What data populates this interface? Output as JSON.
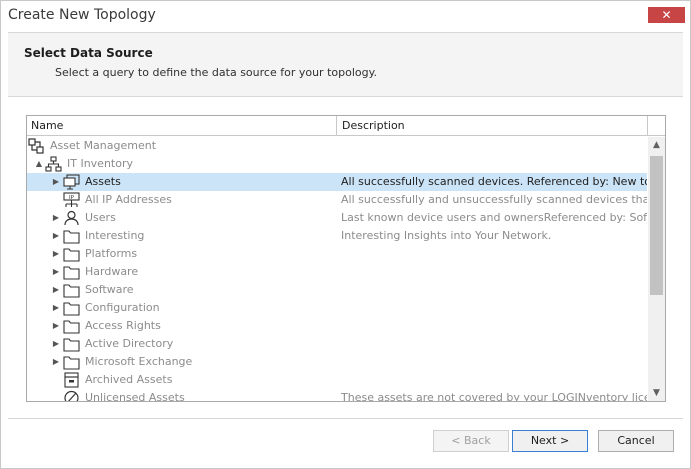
{
  "window": {
    "title": "Create New Topology",
    "close_glyph": "✕"
  },
  "header": {
    "title": "Select Data Source",
    "subtitle": "Select a query to define the data source for your topology."
  },
  "tree": {
    "columns": {
      "name": "Name",
      "description": "Description"
    },
    "rows": [
      {
        "label": "Asset Management",
        "description": "",
        "icon": "network-icon",
        "expander": "",
        "selected": false
      },
      {
        "label": "IT Inventory",
        "description": "",
        "icon": "hierarchy-icon",
        "expander": "▲",
        "selected": false
      },
      {
        "label": "Assets",
        "description": "All successfully scanned devices. Referenced by: New topolo...",
        "icon": "monitor-icon",
        "expander": "▶",
        "selected": true
      },
      {
        "label": "All IP Addresses",
        "description": "All successfully and unsuccessfully scanned devices that hav...",
        "icon": "ip-network-icon",
        "expander": "",
        "selected": false
      },
      {
        "label": "Users",
        "description": "Last known device users and ownersReferenced by: Softwar...",
        "icon": "user-icon",
        "expander": "▶",
        "selected": false
      },
      {
        "label": "Interesting",
        "description": "Interesting Insights into Your Network.",
        "icon": "folder-icon",
        "expander": "▶",
        "selected": false
      },
      {
        "label": "Platforms",
        "description": "",
        "icon": "folder-icon",
        "expander": "▶",
        "selected": false
      },
      {
        "label": "Hardware",
        "description": "",
        "icon": "folder-icon",
        "expander": "▶",
        "selected": false
      },
      {
        "label": "Software",
        "description": "",
        "icon": "folder-icon",
        "expander": "▶",
        "selected": false
      },
      {
        "label": "Configuration",
        "description": "",
        "icon": "folder-icon",
        "expander": "▶",
        "selected": false
      },
      {
        "label": "Access Rights",
        "description": "",
        "icon": "folder-icon",
        "expander": "▶",
        "selected": false
      },
      {
        "label": "Active Directory",
        "description": "",
        "icon": "folder-icon",
        "expander": "▶",
        "selected": false
      },
      {
        "label": "Microsoft Exchange",
        "description": "",
        "icon": "folder-icon",
        "expander": "▶",
        "selected": false
      },
      {
        "label": "Archived Assets",
        "description": "",
        "icon": "archive-icon",
        "expander": "",
        "selected": false
      },
      {
        "label": "Unlicensed Assets",
        "description": "These assets are not covered by your LOGINventory license",
        "icon": "prohibited-icon",
        "expander": "",
        "selected": false
      }
    ]
  },
  "scrollbar": {
    "up_glyph": "▲",
    "down_glyph": "▼"
  },
  "buttons": {
    "back": "< Back",
    "next": "Next >",
    "cancel": "Cancel"
  }
}
